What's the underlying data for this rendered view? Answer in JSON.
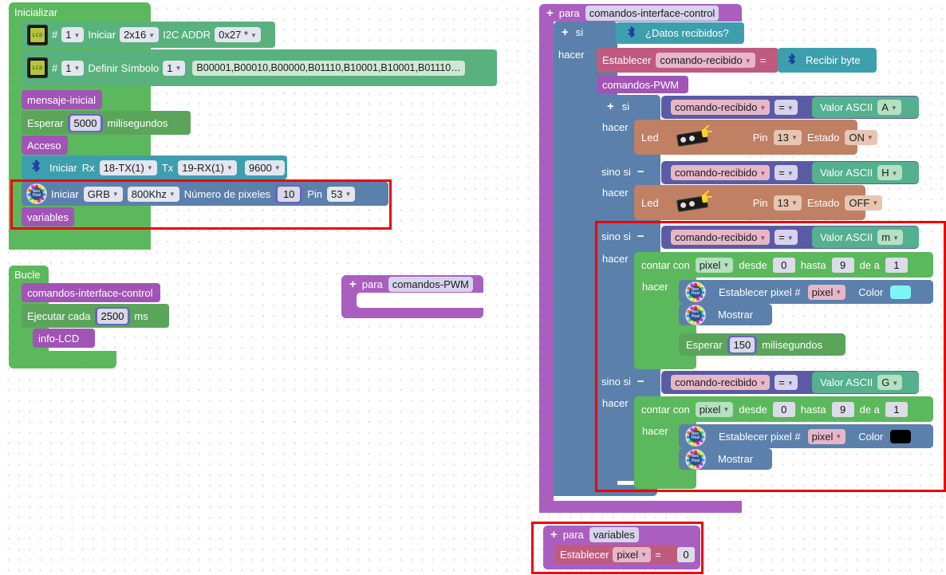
{
  "workspace": {
    "background": "#ffffff",
    "highlight_color": "#f20000"
  },
  "palette": {
    "green": "#5cb85c",
    "purple": "#a154b5",
    "blue": "#5b80ab",
    "bluetooth": "#3d9fae",
    "pink": "#bf5b7e",
    "indigo": "#5b5ba5",
    "teal": "#54b08e",
    "brown": "#c08063",
    "cyan_swatch": "#7ff4f4",
    "black_swatch": "#000000"
  },
  "setup": {
    "title": "Inicializar",
    "lcd_init": {
      "icon": "lcd-icon",
      "hash": "#",
      "number": "1",
      "verb": "Iniciar",
      "size": "2x16",
      "addr_label": "I2C ADDR",
      "addr": "0x27 *"
    },
    "lcd_symbol": {
      "icon": "lcd-icon",
      "hash": "#",
      "number": "1",
      "verb": "Definir Símbolo",
      "symbol": "1",
      "data": "B00001,B00010,B00000,B01110,B10001,B10001,B01110…"
    },
    "call_mensaje": "mensaje-inicial",
    "wait": {
      "verb": "Esperar",
      "value": "5000",
      "unit": "milisegundos"
    },
    "call_acceso": "Acceso",
    "bt_init": {
      "icon": "bluetooth-icon",
      "verb": "Iniciar",
      "rx_label": "Rx",
      "rx": "18-TX(1)",
      "tx_label": "Tx",
      "tx": "19-RX(1)",
      "baud": "9600"
    },
    "neo_init": {
      "icon": "neopixel-icon",
      "verb": "Iniciar",
      "order": "GRB",
      "freq": "800Khz",
      "count_label": "Número de pixeles",
      "count": "10",
      "pin_label": "Pin",
      "pin": "53"
    },
    "call_variables": "variables"
  },
  "loop": {
    "title": "Bucle",
    "call_comandos": "comandos-interface-control",
    "every": {
      "verb": "Ejecutar cada",
      "value": "2500",
      "unit": "ms"
    },
    "call_info_lcd": "info-LCD"
  },
  "proc_pwm": {
    "plus": "+",
    "keyword": "para",
    "name": "comandos-PWM"
  },
  "proc_variables": {
    "plus": "+",
    "keyword": "para",
    "name": "variables",
    "set": {
      "verb": "Establecer",
      "variable": "pixel",
      "equals": "=",
      "value": "0"
    }
  },
  "proc_main": {
    "plus": "+",
    "keyword": "para",
    "name": "comandos-interface-control",
    "if_outer": {
      "plus": "+",
      "if_label": "si",
      "condition_icon": "bluetooth-icon",
      "condition": "¿Datos recibidos?",
      "do_label": "hacer"
    },
    "set_cmd": {
      "verb": "Establecer",
      "variable": "comando-recibido",
      "equals": "=",
      "value_icon": "bluetooth-icon",
      "value": "Recibir byte"
    },
    "call_pwm": "comandos-PWM",
    "branches": [
      {
        "plus": "+",
        "if_label": "si",
        "var": "comando-recibido",
        "op": "=",
        "ascii_label": "Valor ASCII",
        "ascii": "A",
        "do_label": "hacer",
        "action": {
          "type": "led",
          "label": "Led",
          "icon": "led-module-icon",
          "pin_label": "Pin",
          "pin": "13",
          "state_label": "Estado",
          "state": "ON"
        }
      },
      {
        "minus": "−",
        "if_label": "sino si",
        "var": "comando-recibido",
        "op": "=",
        "ascii_label": "Valor ASCII",
        "ascii": "H",
        "do_label": "hacer",
        "action": {
          "type": "led",
          "label": "Led",
          "icon": "led-module-icon",
          "pin_label": "Pin",
          "pin": "13",
          "state_label": "Estado",
          "state": "OFF"
        }
      },
      {
        "minus": "−",
        "if_label": "sino si",
        "var": "comando-recibido",
        "op": "=",
        "ascii_label": "Valor ASCII",
        "ascii": "m",
        "do_label": "hacer",
        "action": {
          "type": "for",
          "count_label": "contar con",
          "count_var": "pixel",
          "from_label": "desde",
          "from": "0",
          "to_label": "hasta",
          "to": "9",
          "by_label": "de a",
          "by": "1",
          "do_label": "hacer",
          "set_pixel": {
            "icon": "neopixel-icon",
            "label": "Establecer pixel #",
            "index_var": "pixel",
            "color_label": "Color",
            "color": "#7ff4f4"
          },
          "show": {
            "icon": "neopixel-icon",
            "label": "Mostrar"
          },
          "wait": {
            "verb": "Esperar",
            "value": "150",
            "unit": "milisegundos"
          }
        }
      },
      {
        "minus": "−",
        "if_label": "sino si",
        "var": "comando-recibido",
        "op": "=",
        "ascii_label": "Valor ASCII",
        "ascii": "G",
        "do_label": "hacer",
        "action": {
          "type": "for",
          "count_label": "contar con",
          "count_var": "pixel",
          "from_label": "desde",
          "from": "0",
          "to_label": "hasta",
          "to": "9",
          "by_label": "de a",
          "by": "1",
          "do_label": "hacer",
          "set_pixel": {
            "icon": "neopixel-icon",
            "label": "Establecer pixel #",
            "index_var": "pixel",
            "color_label": "Color",
            "color": "#000000"
          },
          "show": {
            "icon": "neopixel-icon",
            "label": "Mostrar"
          }
        }
      }
    ]
  }
}
